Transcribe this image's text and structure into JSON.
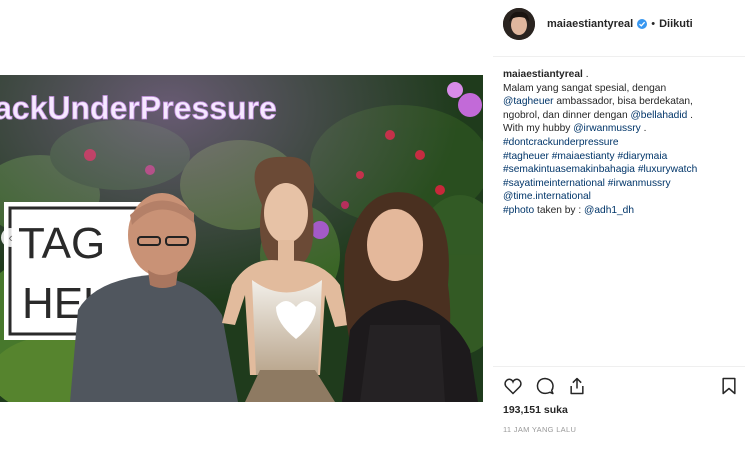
{
  "post": {
    "photo_text": {
      "neon_sign": "ackUnderPressure",
      "logo_line1": "TAG",
      "logo_line2": "HEU"
    },
    "header": {
      "username": "maiaestiantyreal",
      "separator": "•",
      "follow_status": "Diikuti"
    },
    "caption": {
      "username": "maiaestiantyreal",
      "lines": [
        [
          {
            "t": ".",
            "link": false
          }
        ],
        [
          {
            "t": "Malam yang sangat spesial, dengan",
            "link": false
          }
        ],
        [
          {
            "t": "@tagheuer",
            "link": true
          },
          {
            "t": " ambassador, bisa berdekatan,",
            "link": false
          }
        ],
        [
          {
            "t": "ngobrol, dan dinner dengan ",
            "link": false
          },
          {
            "t": "@bellahadid",
            "link": true
          },
          {
            "t": " .",
            "link": false
          }
        ],
        [
          {
            "t": "With my hubby ",
            "link": false
          },
          {
            "t": "@irwanmussry",
            "link": true
          },
          {
            "t": " .",
            "link": false
          }
        ],
        [
          {
            "t": "#dontcrackunderpressure",
            "link": true
          }
        ],
        [
          {
            "t": "#tagheuer",
            "link": true
          },
          {
            "t": " ",
            "link": false
          },
          {
            "t": "#maiaestianty",
            "link": true
          },
          {
            "t": " ",
            "link": false
          },
          {
            "t": "#diarymaia",
            "link": true
          }
        ],
        [
          {
            "t": "#semakintuasemakinbahagia",
            "link": true
          },
          {
            "t": " ",
            "link": false
          },
          {
            "t": "#luxurywatch",
            "link": true
          }
        ],
        [
          {
            "t": "#sayatimeinternational",
            "link": true
          },
          {
            "t": " ",
            "link": false
          },
          {
            "t": "#irwanmussry",
            "link": true
          }
        ],
        [
          {
            "t": "@time.international",
            "link": true
          }
        ],
        [
          {
            "t": "#photo",
            "link": true
          },
          {
            "t": " taken by : ",
            "link": false
          },
          {
            "t": "@adh1_dh",
            "link": true
          }
        ]
      ]
    },
    "actions": {
      "like_icon": "heart-icon",
      "comment_icon": "comment-icon",
      "share_icon": "share-icon",
      "save_icon": "bookmark-icon"
    },
    "likes": "193,151 suka",
    "timestamp": "11 JAM YANG LALU",
    "colors": {
      "link": "#003569",
      "text": "#262626",
      "muted": "#999999",
      "verified": "#3897f0"
    }
  }
}
